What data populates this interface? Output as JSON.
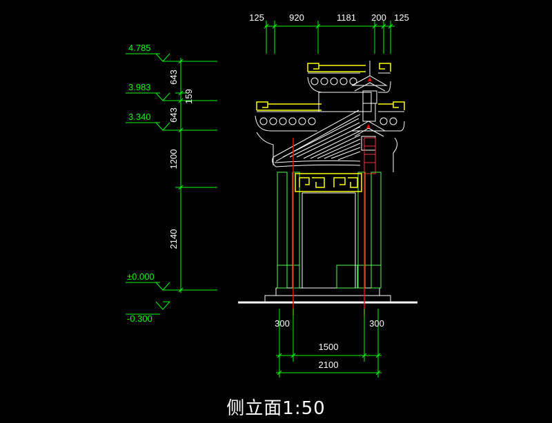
{
  "drawing_title": "侧立面1:50",
  "top_dimensions": [
    "125",
    "920",
    "1181",
    "200",
    "125"
  ],
  "elevations": {
    "top": "4.785",
    "upper_roof": "3.983",
    "lower_roof": "3.340",
    "ground": "±0.000",
    "base": "-0.300"
  },
  "vertical_dimensions": [
    "643",
    "159",
    "643",
    "1200",
    "2140"
  ],
  "bottom_dimensions": {
    "left_offset": "300",
    "right_offset": "300",
    "column_span": "1500",
    "total_width": "2100"
  },
  "colors": {
    "background": "#000000",
    "dimension": "#00ff00",
    "label_text": "#ffffff",
    "elev_text": "#00ff00",
    "structure": "#55ff55",
    "ornament": "#ffff00",
    "roof_line": "#ffffff",
    "accent_red": "#ff0000"
  }
}
